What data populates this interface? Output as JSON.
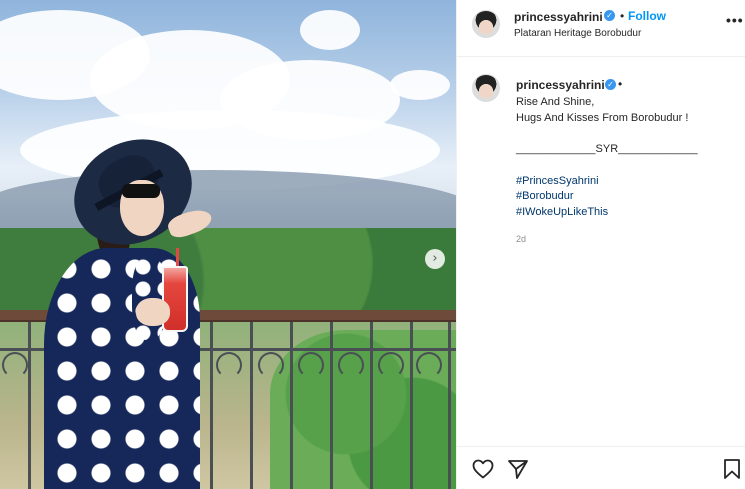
{
  "post": {
    "carousel_next_glyph": "›",
    "username": "princessyahrini",
    "verified_glyph": "✓",
    "separator": "•",
    "follow_label": "Follow",
    "location": "Plataran Heritage Borobudur",
    "more_glyph": "•••"
  },
  "caption": {
    "lines": [
      "Rise And Shine,",
      "Hugs And Kisses From Borobudur !"
    ],
    "signature": "_____________SYR_____________",
    "hashtags": [
      "#PrincesSyahrini",
      "#Borobudur",
      "#IWokeUpLikeThis"
    ],
    "time": "2d"
  },
  "actions": {
    "icons": [
      "heart-icon",
      "share-icon",
      "bookmark-icon"
    ]
  },
  "colors": {
    "follow_blue": "#0095f6",
    "hashtag_blue": "#00376b",
    "verified_blue": "#3897f0",
    "muted_text": "#8e8e8e"
  }
}
